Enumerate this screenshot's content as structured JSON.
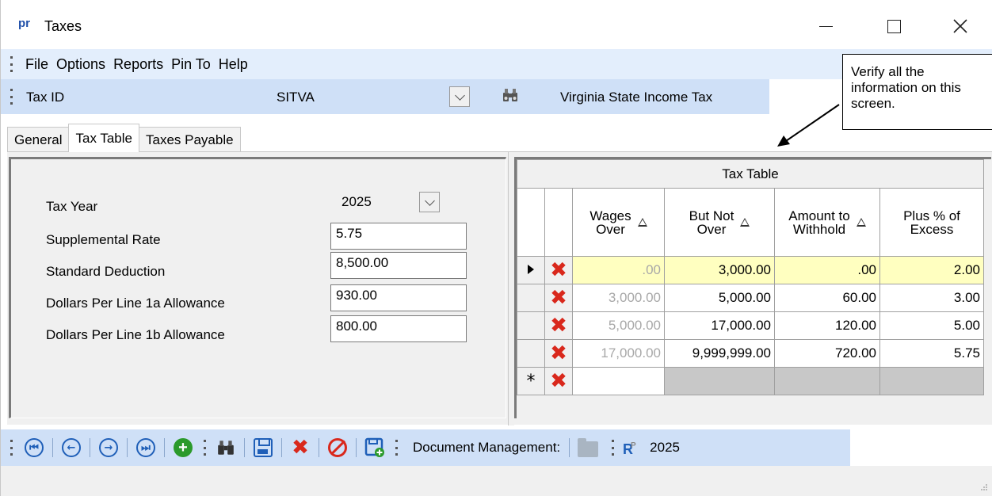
{
  "window": {
    "logo": "pr",
    "title": "Taxes"
  },
  "menu": [
    "File",
    "Options",
    "Reports",
    "Pin To",
    "Help"
  ],
  "taxid": {
    "label": "Tax ID",
    "value": "SITVA",
    "description": "Virginia State Income Tax"
  },
  "callout": "Verify all the information on this screen.",
  "tabs": [
    {
      "label": "General",
      "active": false
    },
    {
      "label": "Tax Table",
      "active": true
    },
    {
      "label": "Taxes Payable",
      "active": false
    }
  ],
  "form": {
    "tax_year": {
      "label": "Tax Year",
      "value": "2025"
    },
    "supplemental_rate": {
      "label": "Supplemental Rate",
      "value": "5.75"
    },
    "standard_deduction": {
      "label": "Standard Deduction",
      "value": "8,500.00"
    },
    "line_1a": {
      "label": "Dollars Per Line 1a Allowance",
      "value": "930.00"
    },
    "line_1b": {
      "label": "Dollars Per Line 1b Allowance",
      "value": "800.00"
    }
  },
  "tax_table": {
    "caption": "Tax Table",
    "columns": [
      {
        "line1": "Wages",
        "line2": "Over",
        "sortable": true
      },
      {
        "line1": "But Not",
        "line2": "Over",
        "sortable": true
      },
      {
        "line1": "Amount to",
        "line2": "Withhold",
        "sortable": true
      },
      {
        "line1": "Plus % of",
        "line2": "Excess",
        "sortable": false
      }
    ],
    "rows": [
      [
        ".00",
        "3,000.00",
        ".00",
        "2.00"
      ],
      [
        "3,000.00",
        "5,000.00",
        "60.00",
        "3.00"
      ],
      [
        "5,000.00",
        "17,000.00",
        "120.00",
        "5.00"
      ],
      [
        "17,000.00",
        "9,999,999.00",
        "720.00",
        "5.75"
      ]
    ],
    "new_row_marker": "*"
  },
  "toolbar": {
    "doc_label": "Document Management:",
    "year": "2025"
  },
  "icons": [
    "first-record-icon",
    "previous-record-icon",
    "next-record-icon",
    "last-record-icon",
    "add-icon",
    "binoculars-icon",
    "save-icon",
    "delete-icon",
    "cancel-icon",
    "save-new-icon",
    "folder-icon",
    "report-icon"
  ]
}
